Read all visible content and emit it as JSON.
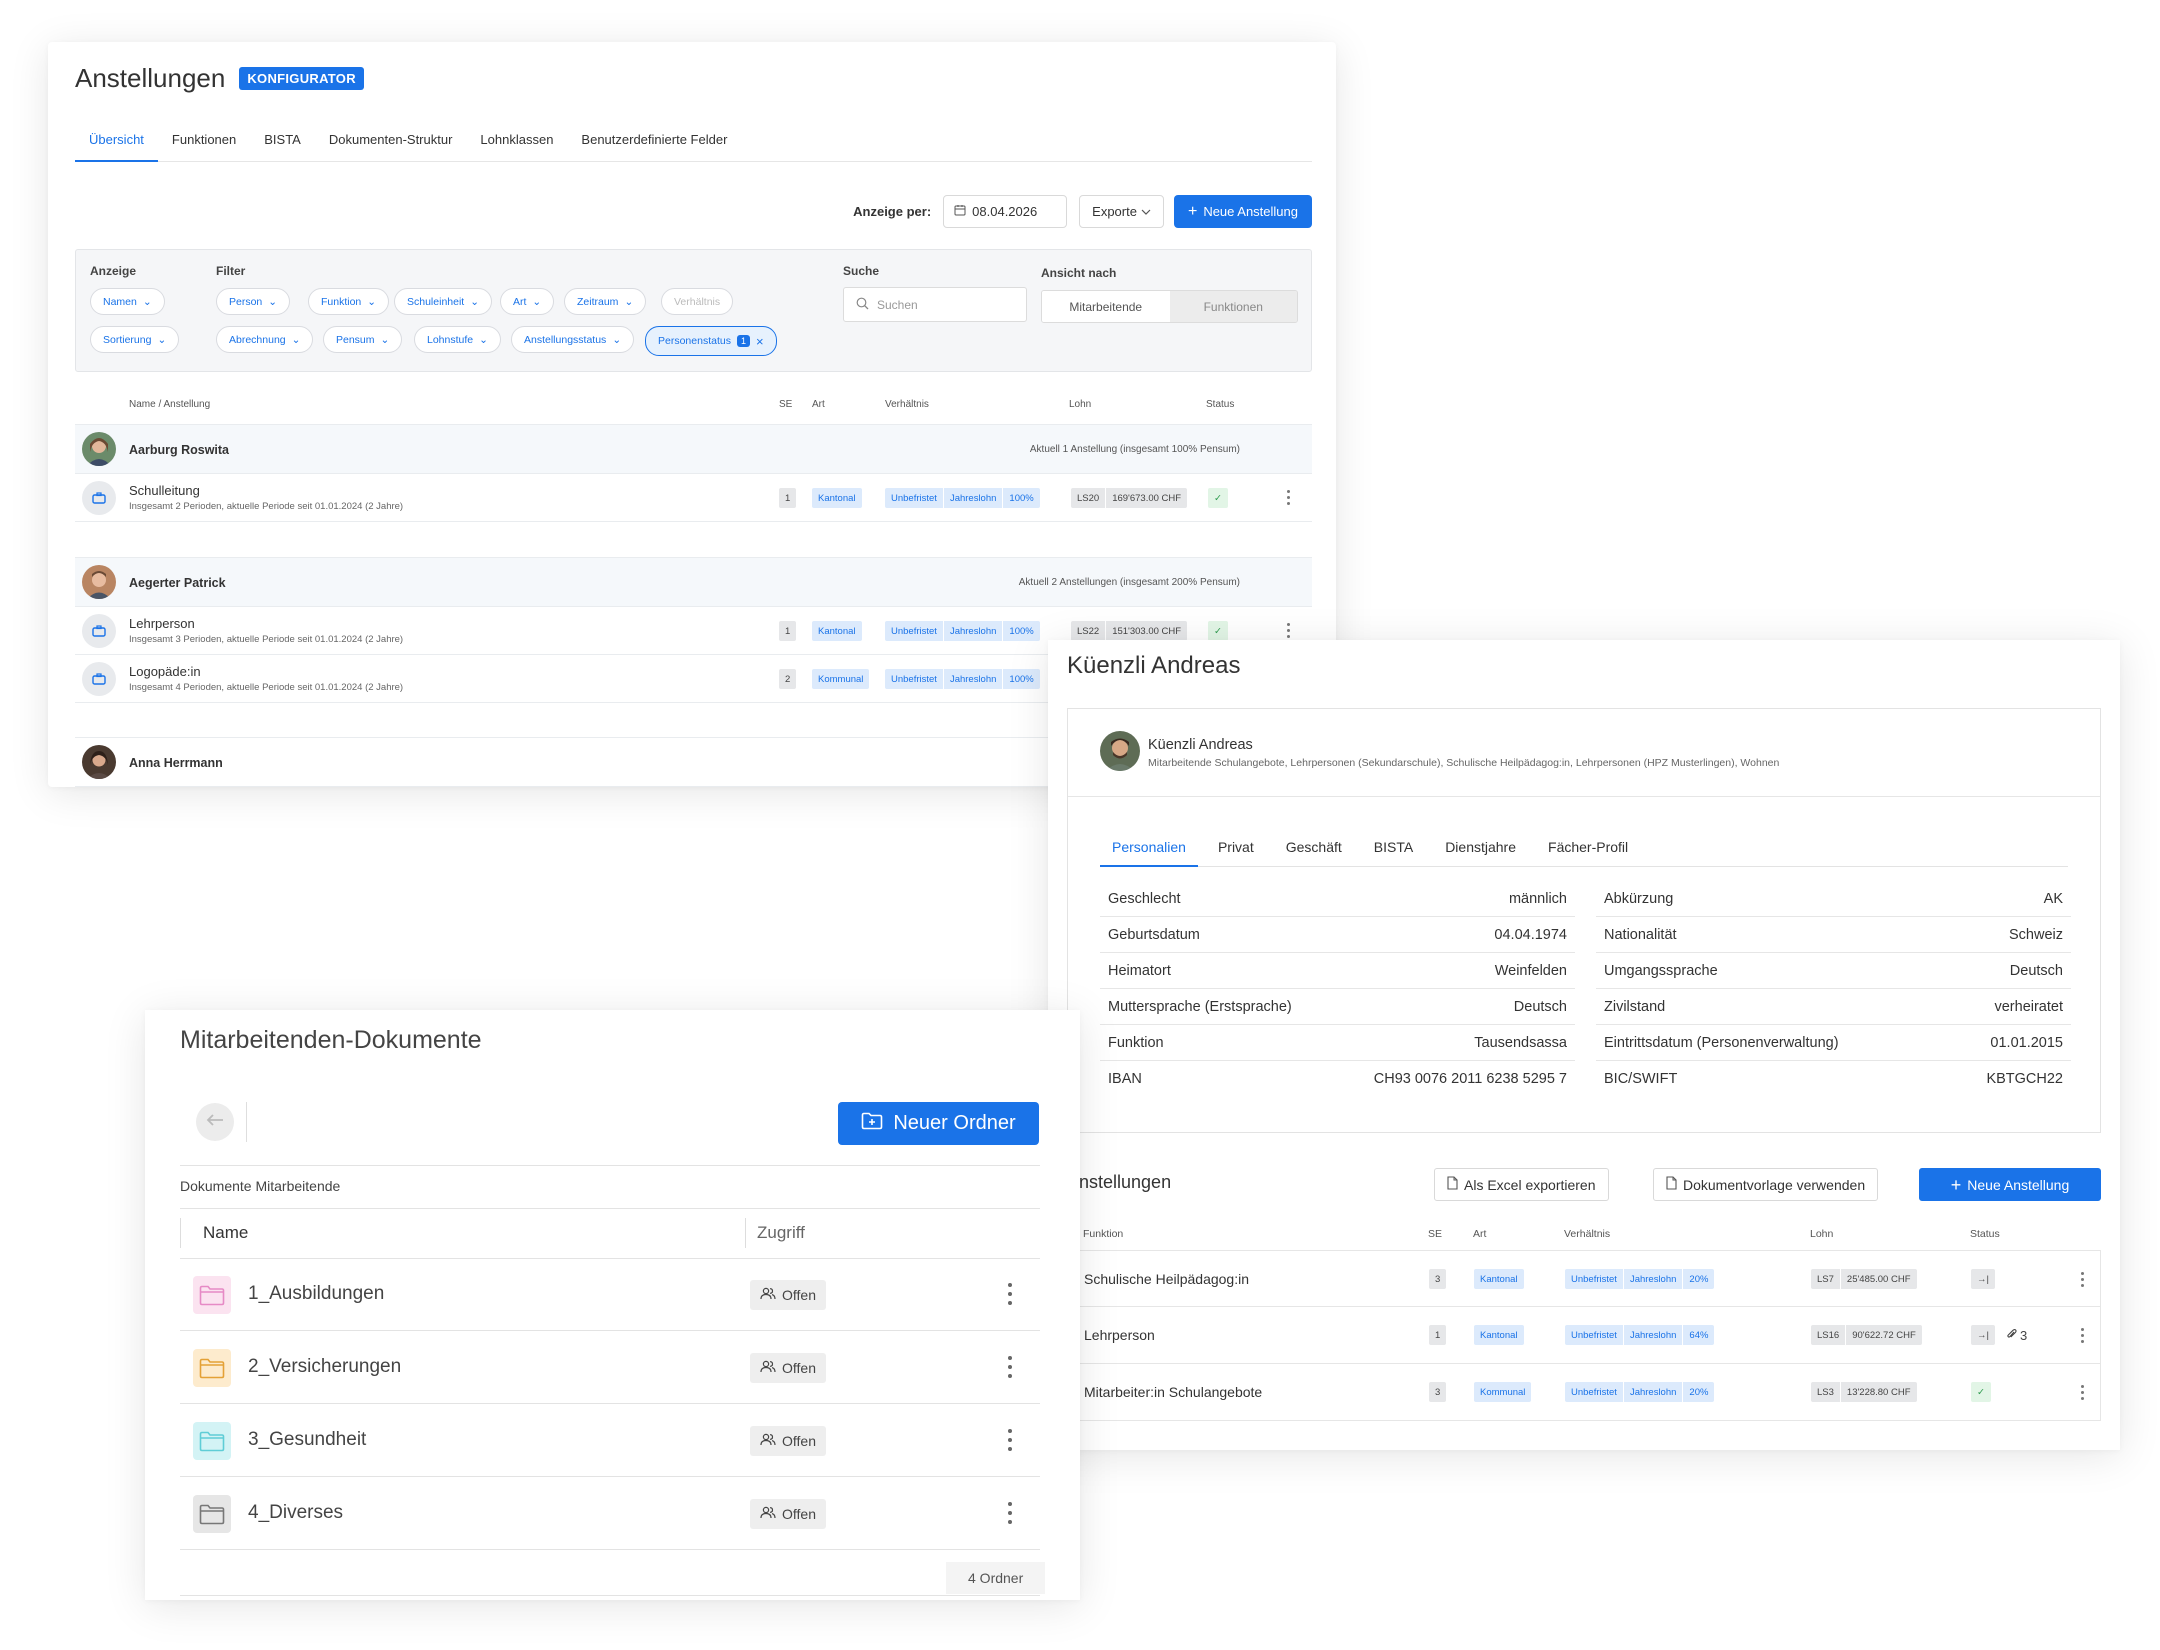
{
  "anstellungen": {
    "title": "Anstellungen",
    "badge": "KONFIGURATOR",
    "tabs": [
      "Übersicht",
      "Funktionen",
      "BISTA",
      "Dokumenten-Struktur",
      "Lohnklassen",
      "Benutzerdefinierte Felder"
    ],
    "anzeige_per_label": "Anzeige per:",
    "date": "08.04.2026",
    "exporte": "Exporte",
    "neue_anstellung": "Neue Anstellung",
    "anzeige_label": "Anzeige",
    "anzeige_chips": [
      "Namen",
      "Sortierung"
    ],
    "filter_label": "Filter",
    "filter_chips_row1": [
      "Person",
      "Funktion",
      "Schuleinheit",
      "Art",
      "Zeitraum"
    ],
    "filter_disabled": "Verhältnis",
    "filter_chips_row2": [
      "Abrechnung",
      "Pensum",
      "Lohnstufe",
      "Anstellungsstatus"
    ],
    "filter_selected": "Personenstatus",
    "filter_selected_count": "1",
    "suche_label": "Suche",
    "suche_placeholder": "Suchen",
    "ansicht_label": "Ansicht nach",
    "ansicht_options": [
      "Mitarbeitende",
      "Funktionen"
    ],
    "table_headers": [
      "Name / Anstellung",
      "SE",
      "Art",
      "Verhältnis",
      "Lohn",
      "Status"
    ],
    "persons": [
      {
        "name": "Aarburg Roswita",
        "info": "Aktuell 1 Anstellung (insgesamt 100% Pensum)",
        "jobs": [
          {
            "title": "Schulleitung",
            "sub": "Insgesamt 2 Perioden, aktuelle Periode seit 01.01.2024 (2 Jahre)",
            "se": "1",
            "art": "Kantonal",
            "verh": [
              "Unbefristet",
              "Jahreslohn",
              "100%"
            ],
            "lohn": [
              "LS20",
              "169'673.00 CHF"
            ],
            "status": "✓"
          }
        ]
      },
      {
        "name": "Aegerter Patrick",
        "info": "Aktuell 2 Anstellungen (insgesamt 200% Pensum)",
        "jobs": [
          {
            "title": "Lehrperson",
            "sub": "Insgesamt 3 Perioden, aktuelle Periode seit 01.01.2024 (2 Jahre)",
            "se": "1",
            "art": "Kantonal",
            "verh": [
              "Unbefristet",
              "Jahreslohn",
              "100%"
            ],
            "lohn": [
              "LS22",
              "151'303.00 CHF"
            ],
            "status": "✓"
          },
          {
            "title": "Logopäde:in",
            "sub": "Insgesamt 4 Perioden, aktuelle Periode seit 01.01.2024 (2 Jahre)",
            "se": "2",
            "art": "Kommunal",
            "verh": [
              "Unbefristet",
              "Jahreslohn",
              "100%"
            ]
          }
        ]
      },
      {
        "name": "Anna Herrmann"
      }
    ]
  },
  "person_detail": {
    "title": "Küenzli Andreas",
    "name": "Küenzli Andreas",
    "subtitle": "Mitarbeitende Schulangebote, Lehrpersonen (Sekundarschule), Schulische Heilpädagog:in, Lehrpersonen (HPZ Musterlingen), Wohnen",
    "tabs": [
      "Personalien",
      "Privat",
      "Geschäft",
      "BISTA",
      "Dienstjahre",
      "Fächer-Profil"
    ],
    "left_fields": [
      {
        "label": "Geschlecht",
        "value": "männlich"
      },
      {
        "label": "Geburtsdatum",
        "value": "04.04.1974"
      },
      {
        "label": "Heimatort",
        "value": "Weinfelden"
      },
      {
        "label": "Muttersprache (Erstsprache)",
        "value": "Deutsch"
      },
      {
        "label": "Funktion",
        "value": "Tausendsassa"
      },
      {
        "label": "IBAN",
        "value": "CH93 0076 2011 6238 5295 7"
      }
    ],
    "right_fields": [
      {
        "label": "Abkürzung",
        "value": "AK"
      },
      {
        "label": "Nationalität",
        "value": "Schweiz"
      },
      {
        "label": "Umgangssprache",
        "value": "Deutsch"
      },
      {
        "label": "Zivilstand",
        "value": "verheiratet"
      },
      {
        "label": "Eintrittsdatum (Personenverwaltung)",
        "value": "01.01.2015"
      },
      {
        "label": "BIC/SWIFT",
        "value": "KBTGCH22"
      }
    ],
    "anst_title": "Anstellungen",
    "btn_excel": "Als Excel exportieren",
    "btn_vorlage": "Dokumentvorlage verwenden",
    "btn_neu": "Neue Anstellung",
    "table_headers": [
      "Funktion",
      "SE",
      "Art",
      "Verhältnis",
      "Lohn",
      "Status"
    ],
    "rows": [
      {
        "name": "Schulische Heilpädagog:in",
        "se": "3",
        "art": "Kantonal",
        "verh": [
          "Unbefristet",
          "Jahreslohn",
          "20%"
        ],
        "lohn": [
          "LS7",
          "25'485.00 CHF"
        ],
        "status": "→|"
      },
      {
        "name": "Lehrperson",
        "se": "1",
        "art": "Kantonal",
        "verh": [
          "Unbefristet",
          "Jahreslohn",
          "64%"
        ],
        "lohn": [
          "LS16",
          "90'622.72 CHF"
        ],
        "status": "→|",
        "attachments": "3"
      },
      {
        "name": "Mitarbeiter:in Schulangebote",
        "se": "3",
        "art": "Kommunal",
        "verh": [
          "Unbefristet",
          "Jahreslohn",
          "20%"
        ],
        "lohn": [
          "LS3",
          "13'228.80 CHF"
        ],
        "status": "✓"
      }
    ]
  },
  "documents": {
    "title": "Mitarbeitenden-Dokumente",
    "new_folder": "Neuer Ordner",
    "breadcrumb": "Dokumente Mitarbeitende",
    "col_name": "Name",
    "col_access": "Zugriff",
    "folders": [
      {
        "name": "1_Ausbildungen",
        "access": "Offen",
        "color": "#f7c6e3"
      },
      {
        "name": "2_Versicherungen",
        "access": "Offen",
        "color": "#f8d9a8"
      },
      {
        "name": "3_Gesundheit",
        "access": "Offen",
        "color": "#b9ecef"
      },
      {
        "name": "4_Diverses",
        "access": "Offen",
        "color": "#d5d5d5"
      }
    ],
    "count": "4 Ordner"
  },
  "colors": {
    "accent": "#1a73e8",
    "tag_blue_bg": "#dceafc",
    "success_bg": "#e2f5e6"
  }
}
